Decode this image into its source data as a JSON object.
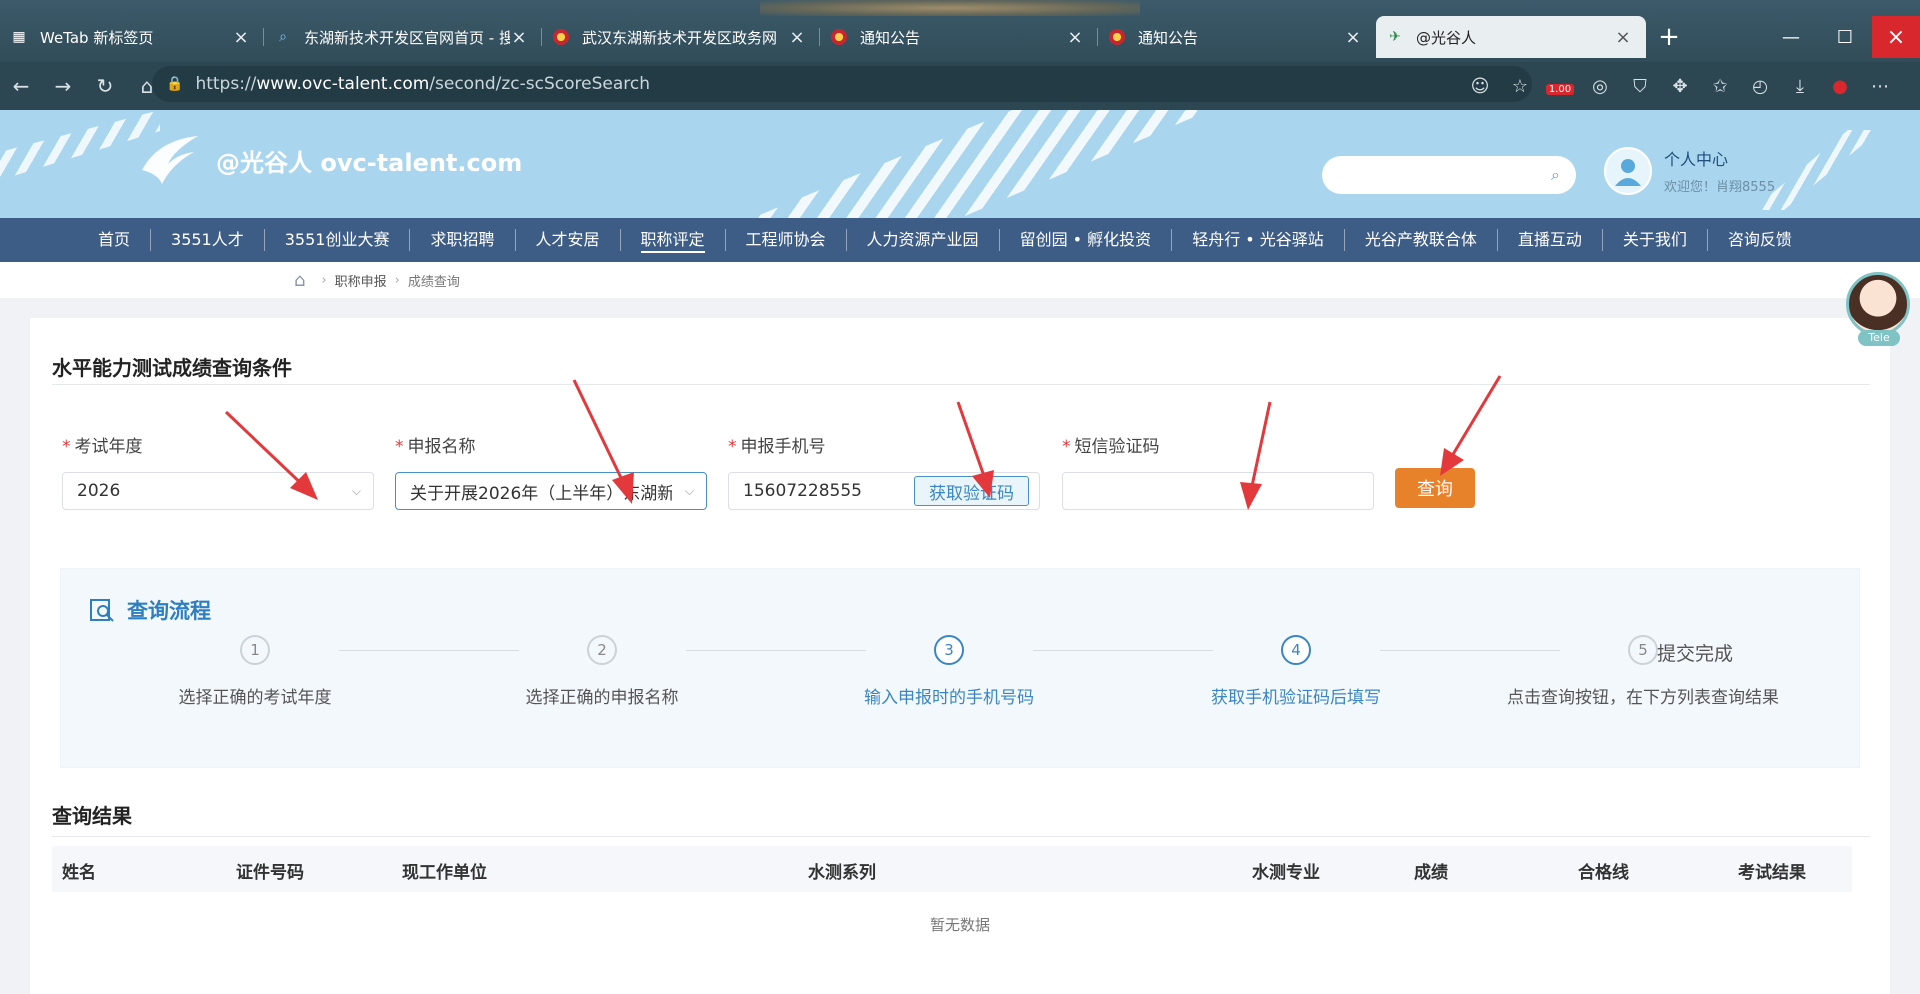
{
  "browser": {
    "tabs": [
      {
        "title": "WeTab 新标签页",
        "icon": "grid-icon",
        "active": false
      },
      {
        "title": "东湖新技术开发区官网首页 - 搜索",
        "icon": "search-icon",
        "active": false
      },
      {
        "title": "武汉东湖新技术开发区政务网",
        "icon": "emblem-icon",
        "active": false
      },
      {
        "title": "通知公告",
        "icon": "emblem-icon",
        "active": false
      },
      {
        "title": "通知公告",
        "icon": "emblem-icon",
        "active": false
      },
      {
        "title": "@光谷人",
        "icon": "site-logo-icon",
        "active": true
      }
    ],
    "url_prefix": "https://",
    "url_host": "www.ovc-talent.com",
    "url_path": "/second/zc-scScoreSearch",
    "badge": "1.00"
  },
  "header": {
    "logo_text": "@光谷人 ovc-talent.com",
    "user_center": "个人中心",
    "welcome": "欢迎您！肖翔8555"
  },
  "nav": {
    "items": [
      "首页",
      "3551人才",
      "3551创业大赛",
      "求职招聘",
      "人才安居",
      "职称评定",
      "工程师协会",
      "人力资源产业园",
      "留创园 • 孵化投资",
      "轻舟行 • 光谷驿站",
      "光谷产教联合体",
      "直播互动",
      "关于我们",
      "咨询反馈"
    ],
    "current": "职称评定"
  },
  "breadcrumb": {
    "level1": "职称申报",
    "level2": "成绩查询"
  },
  "query_form": {
    "title": "水平能力测试成绩查询条件",
    "required_mark": "*",
    "fields": {
      "year": {
        "label": "考试年度",
        "value": "2026"
      },
      "name": {
        "label": "申报名称",
        "value": "关于开展2026年（上半年）东湖新"
      },
      "phone": {
        "label": "申报手机号",
        "value": "15607228555"
      },
      "sms": {
        "label": "短信验证码",
        "value": ""
      }
    },
    "sms_button": "获取验证码",
    "query_button": "查询"
  },
  "process": {
    "title": "查询流程",
    "steps": [
      {
        "num": "1",
        "desc": "选择正确的考试年度"
      },
      {
        "num": "2",
        "desc": "选择正确的申报名称"
      },
      {
        "num": "3",
        "desc": "输入申报时的手机号码"
      },
      {
        "num": "4",
        "desc": "获取手机验证码后填写"
      },
      {
        "num": "5",
        "desc": "点击查询按钮，在下方列表查询结果"
      }
    ],
    "step5_label": "提交完成"
  },
  "results": {
    "title": "查询结果",
    "columns": [
      "姓名",
      "证件号码",
      "现工作单位",
      "水测系列",
      "水测专业",
      "成绩",
      "合格线",
      "考试结果"
    ],
    "empty": "暂无数据"
  },
  "assistant": {
    "label": "Tele"
  },
  "colors": {
    "accent": "#3a86c4",
    "nav_bg": "#3e5d86",
    "query_button": "#e8822a",
    "arrow": "#e4393c"
  }
}
